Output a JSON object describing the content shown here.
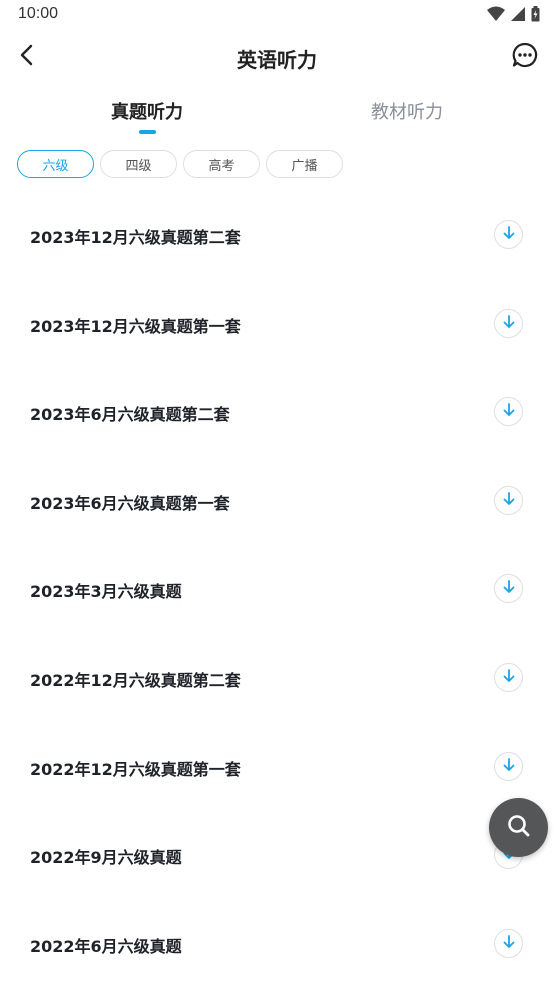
{
  "status_bar": {
    "time": "10:00",
    "icons": [
      "wifi-icon",
      "signal-icon",
      "battery-icon"
    ]
  },
  "header": {
    "title": "英语听力",
    "back_icon": "chevron-left-icon",
    "message_icon": "chat-bubble-icon"
  },
  "tabs": [
    {
      "label": "真题听力",
      "active": true
    },
    {
      "label": "教材听力",
      "active": false
    }
  ],
  "filter_chips": [
    {
      "label": "六级",
      "selected": true
    },
    {
      "label": "四级",
      "selected": false
    },
    {
      "label": "高考",
      "selected": false
    },
    {
      "label": "广播",
      "selected": false
    }
  ],
  "list": {
    "items": [
      {
        "title": "2023年12月六级真题第二套"
      },
      {
        "title": "2023年12月六级真题第一套"
      },
      {
        "title": "2023年6月六级真题第二套"
      },
      {
        "title": "2023年6月六级真题第一套"
      },
      {
        "title": "2023年3月六级真题"
      },
      {
        "title": "2022年12月六级真题第二套"
      },
      {
        "title": "2022年12月六级真题第一套"
      },
      {
        "title": "2022年9月六级真题"
      },
      {
        "title": "2022年6月六级真题"
      }
    ],
    "download_icon": "download-arrow-icon"
  },
  "fab": {
    "icon": "search-icon"
  },
  "colors": {
    "accent": "#1aa4e8",
    "fab_bg": "#555658",
    "inactive_text": "#8a8f99"
  }
}
